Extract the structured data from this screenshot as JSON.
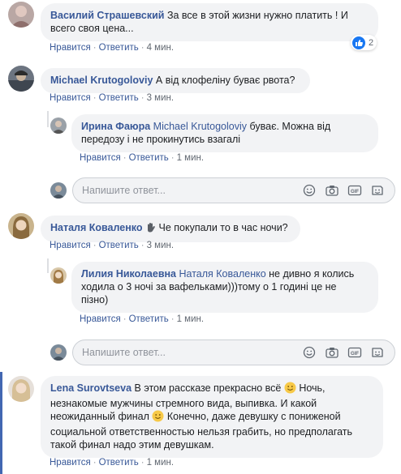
{
  "colors": {
    "link": "#385898",
    "bubble": "#f2f3f5",
    "meta": "#606770",
    "like": "#1877f2",
    "highlight": "#4267b2"
  },
  "comments": [
    {
      "author": "Василий Страшевский",
      "text_line1": "За все в этой жизни нужно платить ! И",
      "text_line2": "всего своя цена...",
      "like": "Нравится",
      "reply": "Ответить",
      "time": "4 мин.",
      "reaction_count": "2"
    },
    {
      "author": "Michael Krutogoloviy",
      "text": "А від клофеліну буває рвота?",
      "like": "Нравится",
      "reply": "Ответить",
      "time": "3 мин.",
      "replies": [
        {
          "author": "Ирина Фаюра",
          "mention": "Michael Krutogoloviy",
          "text_line1": "буває. Можна від",
          "text_line2": "передозу і не прокинутись взагалі",
          "like": "Нравится",
          "reply": "Ответить",
          "time": "1 мин."
        }
      ]
    },
    {
      "author": "Наталя Коваленко",
      "text": "Че покупали то в час ночи?",
      "like": "Нравится",
      "reply": "Ответить",
      "time": "3 мин.",
      "replies": [
        {
          "author": "Лилия Николаевна",
          "mention": "Наталя Коваленко",
          "text_line1": "не дивно я колись",
          "text_line2": "ходила о 3 ночі за вафельками)))тому о 1 годині це не",
          "text_line3": "пізно)",
          "like": "Нравится",
          "reply": "Ответить",
          "time": "1 мин."
        }
      ]
    },
    {
      "author": "Lena Surovtseva",
      "text_line1": "В этом рассказе прекрасно всё",
      "text_line1b": "Ночь,",
      "text_line2": "незнакомые мужчины стремного вида, выпивка. И какой",
      "text_line3": "неожиданный финал",
      "text_line3b": "Конечно, даже девушку с пониженой",
      "text_line4": "социальной ответственностью нельзя грабить, но предполагать",
      "text_line5": "такой финал надо этим девушкам.",
      "like": "Нравится",
      "reply": "Ответить",
      "time": "1 мин."
    }
  ],
  "composer": {
    "placeholder": "Напишите ответ..."
  },
  "icons": [
    "emoji-icon",
    "camera-icon",
    "gif-icon",
    "sticker-icon",
    "like-icon",
    "hand-emoji-icon",
    "smile-emoji-icon"
  ]
}
